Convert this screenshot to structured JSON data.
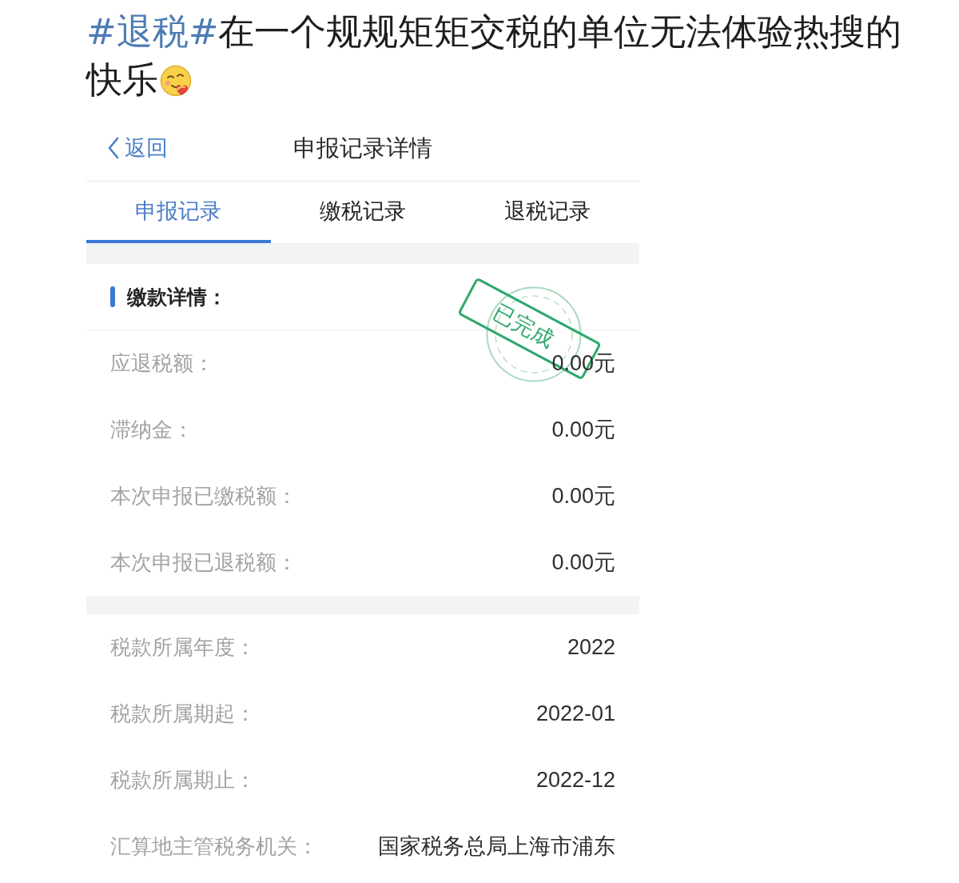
{
  "post": {
    "hashtag": "#退税#",
    "text": "在一个规规矩矩交税的单位无法体验热搜的快乐"
  },
  "screen": {
    "back": "返回",
    "title": "申报记录详情",
    "tabs": [
      {
        "label": "申报记录",
        "selected": true
      },
      {
        "label": "缴税记录",
        "selected": false
      },
      {
        "label": "退税记录",
        "selected": false
      }
    ],
    "payment_section": {
      "title": "缴款详情：",
      "stamp": "已完成",
      "rows": [
        {
          "label": "应退税额：",
          "value": "0.00元"
        },
        {
          "label": "滞纳金：",
          "value": "0.00元"
        },
        {
          "label": "本次申报已缴税额：",
          "value": "0.00元"
        },
        {
          "label": "本次申报已退税额：",
          "value": "0.00元"
        }
      ]
    },
    "period_rows": [
      {
        "label": "税款所属年度：",
        "value": "2022"
      },
      {
        "label": "税款所属期起：",
        "value": "2022-01"
      },
      {
        "label": "税款所属期止：",
        "value": "2022-12"
      },
      {
        "label": "汇算地主管税务机关：",
        "value": "国家税务总局上海市浦东"
      }
    ]
  }
}
